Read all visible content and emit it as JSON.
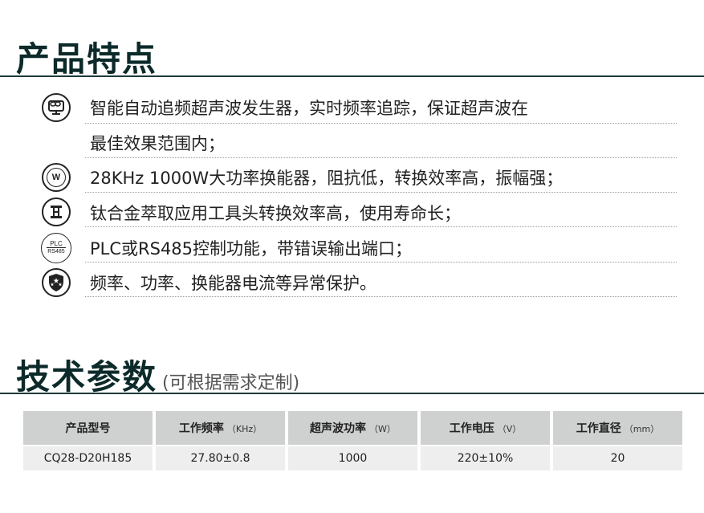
{
  "features": {
    "title": "产品特点",
    "items": [
      {
        "icon": "monitor-icon",
        "lines": [
          "智能自动追频超声波发生器，实时频率追踪，保证超声波在",
          "最佳效果范围内；"
        ]
      },
      {
        "icon": "watt-icon",
        "icon_text": "W",
        "lines": [
          "28KHz 1000W大功率换能器，阻抗低，转换效率高，振幅强；"
        ]
      },
      {
        "icon": "tool-head-icon",
        "lines": [
          "钛合金萃取应用工具头转换效率高，使用寿命长；"
        ]
      },
      {
        "icon": "plc-rs485-icon",
        "icon_text_top": "PLC",
        "icon_text_bottom": "RS485",
        "lines": [
          "PLC或RS485控制功能，带错误输出端口；"
        ]
      },
      {
        "icon": "shield-icon",
        "lines": [
          "频率、功率、换能器电流等异常保护。"
        ]
      }
    ]
  },
  "specs": {
    "title": "技术参数",
    "subtitle": "(可根据需求定制)",
    "headers": [
      {
        "label": "产品型号",
        "unit": ""
      },
      {
        "label": "工作频率",
        "unit": "（KHz）"
      },
      {
        "label": "超声波功率",
        "unit": "（W）"
      },
      {
        "label": "工作电压",
        "unit": "（V）"
      },
      {
        "label": "工作直径",
        "unit": "（mm）"
      }
    ],
    "rows": [
      [
        "CQ28-D20H185",
        "27.80±0.8",
        "1000",
        "220±10%",
        "20"
      ]
    ]
  }
}
